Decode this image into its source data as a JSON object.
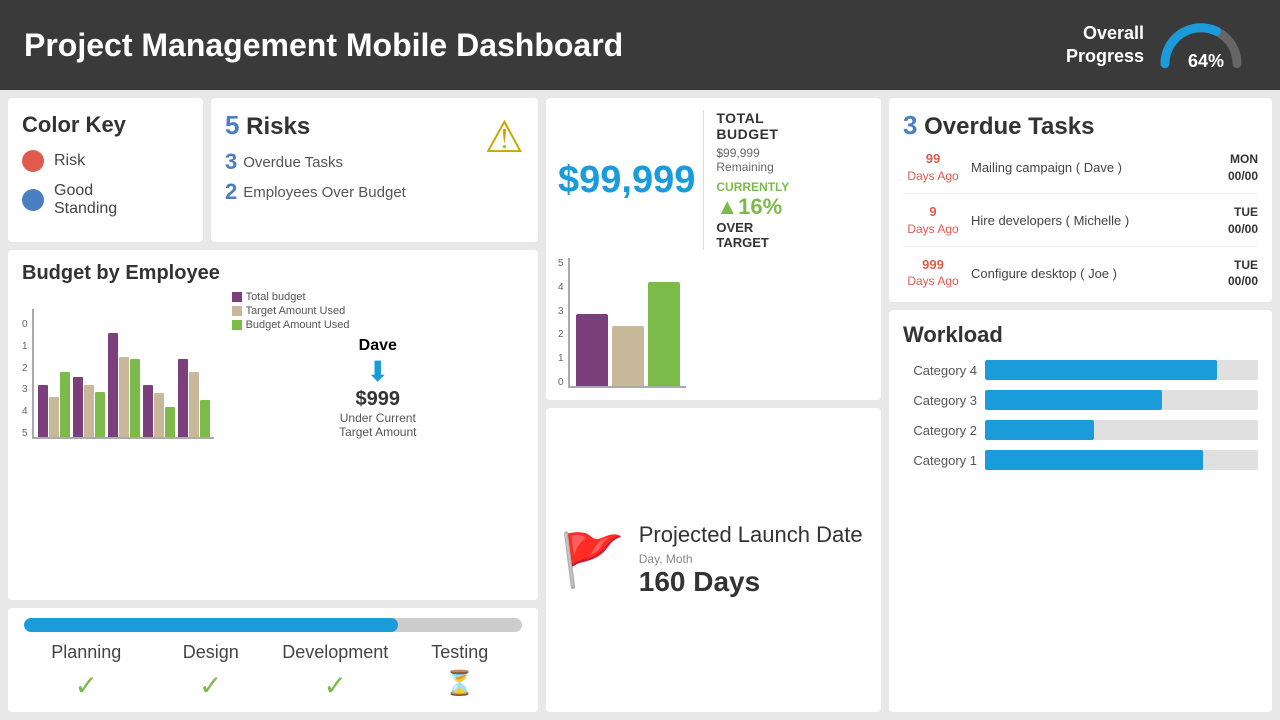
{
  "header": {
    "title": "Project Management Mobile Dashboard",
    "overall_progress_label": "Overall\nProgress",
    "overall_progress_value": "64%"
  },
  "color_key": {
    "title": "Color Key",
    "items": [
      {
        "label": "Risk",
        "color": "risk"
      },
      {
        "label": "Good\nStanding",
        "color": "good"
      }
    ]
  },
  "risks": {
    "count": "5",
    "label": "Risks",
    "overdue_count": "3",
    "overdue_label": "Overdue Tasks",
    "over_budget_count": "2",
    "over_budget_label": "Employees Over Budget"
  },
  "budget_employee": {
    "title": "Budget by Employee",
    "legend": [
      {
        "label": "Total budget",
        "color": "purple"
      },
      {
        "label": "Target Amount Used",
        "color": "tan"
      },
      {
        "label": "Budget Amount Used",
        "color": "green"
      }
    ],
    "dave": {
      "name": "Dave",
      "amount": "$999",
      "sub": "Under Current\nTarget Amount"
    }
  },
  "budget_stats": {
    "big_amount": "$99,999",
    "label": "TOTAL\nBUDGET",
    "remaining_label": "$99,999\nRemaining",
    "currently_label": "CURRENTLY",
    "pct": "▲16%",
    "over_target": "OVER\nTARGET"
  },
  "launch": {
    "title": "Projected\nLaunch Date",
    "sub": "Day, Moth",
    "days": "160 Days"
  },
  "stages": [
    {
      "label": "Planning",
      "done": true
    },
    {
      "label": "Design",
      "done": true
    },
    {
      "label": "Development",
      "done": true
    },
    {
      "label": "Testing",
      "done": false
    }
  ],
  "overdue_tasks": {
    "title": "Overdue Tasks",
    "count": "3",
    "tasks": [
      {
        "days_ago": "99\nDays Ago",
        "desc": "Mailing campaign ( Dave )",
        "day": "MON\n00/00"
      },
      {
        "days_ago": "9\nDays Ago",
        "desc": "Hire developers\n( Michelle )",
        "day": "TUE\n00/00"
      },
      {
        "days_ago": "999\nDays Ago",
        "desc": "Configure desktop (\nJoe )",
        "day": "TUE\n00/00"
      }
    ]
  },
  "workload": {
    "title": "Workload",
    "categories": [
      {
        "label": "Category 4",
        "pct": 85
      },
      {
        "label": "Category 3",
        "pct": 65
      },
      {
        "label": "Category 2",
        "pct": 40
      },
      {
        "label": "Category 1",
        "pct": 80
      }
    ]
  }
}
